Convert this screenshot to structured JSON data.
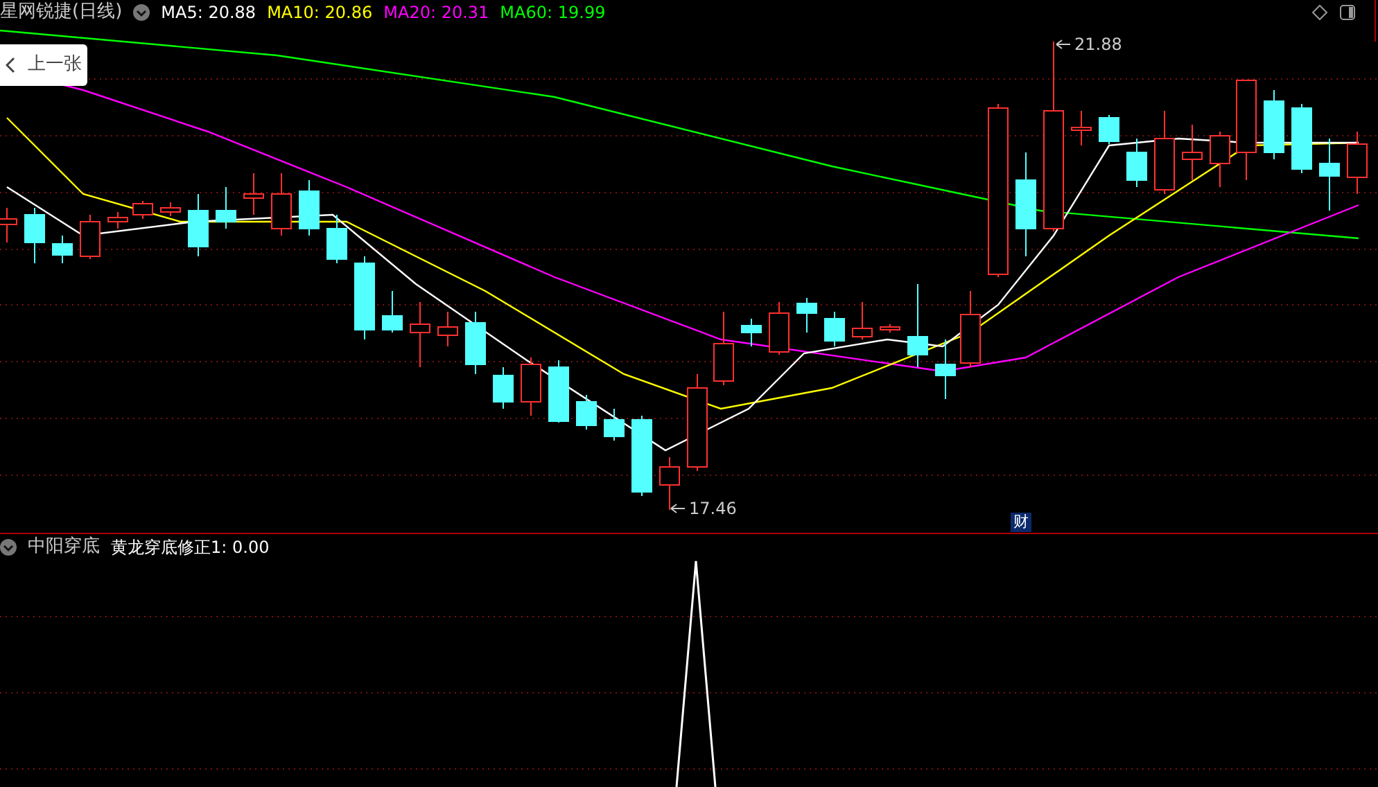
{
  "header": {
    "title": "星网锐捷(日线)",
    "moving_averages": [
      {
        "label": "MA5:",
        "value": "20.88",
        "color": "#ffffff"
      },
      {
        "label": "MA10:",
        "value": "20.86",
        "color": "#ffff00"
      },
      {
        "label": "MA20:",
        "value": "20.31",
        "color": "#ff00ff"
      },
      {
        "label": "MA60:",
        "value": "19.99",
        "color": "#00ff00"
      }
    ]
  },
  "back_button": {
    "label": "上一张"
  },
  "price_chart": {
    "high_label": "21.88",
    "low_label": "17.46",
    "badge": "财"
  },
  "indicator": {
    "name": "中阳穿底",
    "series": [
      {
        "label": "黄龙穿底修正1:",
        "value": "0.00",
        "color": "#ffffff"
      }
    ]
  }
}
